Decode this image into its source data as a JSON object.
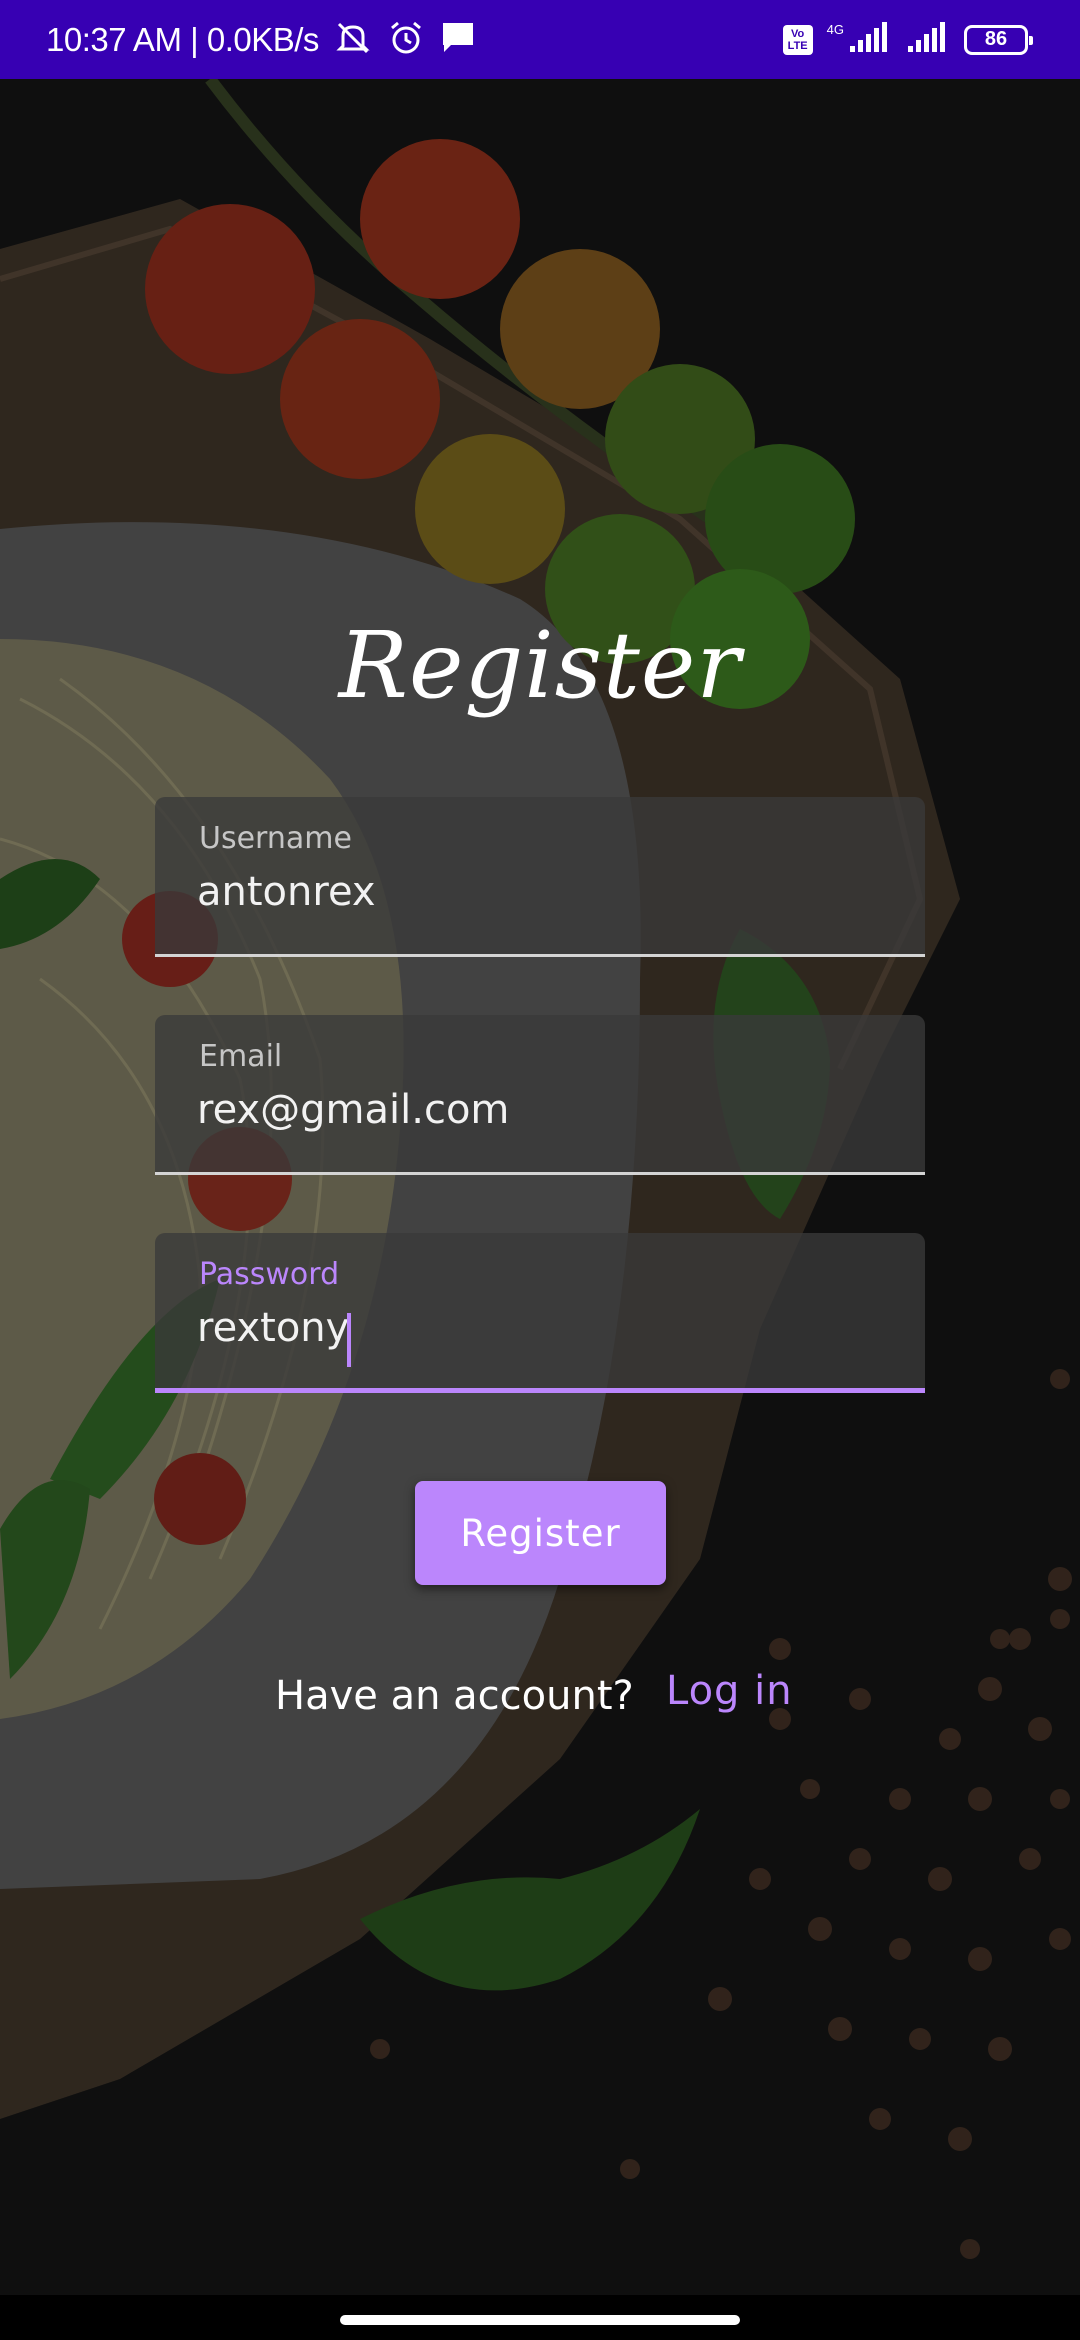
{
  "status_bar": {
    "time": "10:37 AM | 0.0KB/s",
    "volte_label": "Vo\nLTE",
    "network_type": "4G",
    "battery": "86",
    "background_color": "#3700b3"
  },
  "icons": {
    "status_left": [
      "mute-icon",
      "alarm-icon",
      "message-icon"
    ],
    "status_right": [
      "volte-icon",
      "signal-icon",
      "signal-icon",
      "battery-icon"
    ]
  },
  "screen": {
    "title": "Register",
    "fields": {
      "username": {
        "label": "Username",
        "value": "antonrex"
      },
      "email": {
        "label": "Email",
        "value": "rex@gmail.com"
      },
      "password": {
        "label": "Password",
        "value": "rextony"
      }
    },
    "register_button": "Register",
    "have_account_text": "Have an account?",
    "login_link": "Log in"
  },
  "colors": {
    "accent": "#bb86fc",
    "background": "#121212"
  }
}
